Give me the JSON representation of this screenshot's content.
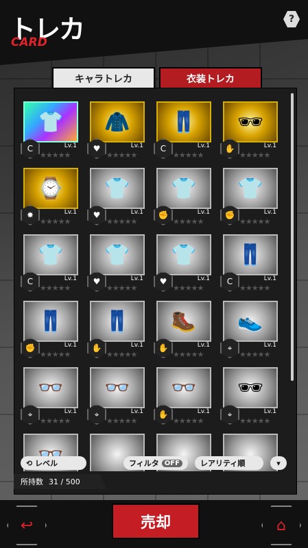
{
  "header": {
    "title": "トレカ",
    "subtitle": "CARD",
    "help": "?"
  },
  "tabs": [
    {
      "label": "キャラトレカ",
      "active": false
    },
    {
      "label": "衣装トレカ",
      "active": true
    }
  ],
  "cards": [
    {
      "icon": "👕",
      "frame": "rainbow",
      "level": "Lv.1",
      "badge": "c"
    },
    {
      "icon": "🧥",
      "frame": "gold",
      "level": "Lv.1",
      "badge": "heart"
    },
    {
      "icon": "👖",
      "frame": "gold",
      "level": "Lv.1",
      "badge": "c"
    },
    {
      "icon": "🕶",
      "frame": "gold",
      "level": "Lv.1",
      "badge": "hand"
    },
    {
      "icon": "⌚",
      "frame": "gold",
      "level": "Lv.1",
      "badge": "burst"
    },
    {
      "icon": "👕",
      "frame": "silver",
      "level": "Lv.1",
      "badge": "heart"
    },
    {
      "icon": "👕",
      "frame": "silver",
      "level": "Lv.1",
      "badge": "fist"
    },
    {
      "icon": "👕",
      "frame": "silver",
      "level": "Lv.1",
      "badge": "fist"
    },
    {
      "icon": "👕",
      "frame": "silver",
      "level": "Lv.1",
      "badge": "c"
    },
    {
      "icon": "👕",
      "frame": "silver",
      "level": "Lv.1",
      "badge": "heart"
    },
    {
      "icon": "👕",
      "frame": "silver",
      "level": "Lv.1",
      "badge": "heart"
    },
    {
      "icon": "👖",
      "frame": "silver",
      "level": "Lv.1",
      "badge": "c"
    },
    {
      "icon": "👖",
      "frame": "silver",
      "level": "Lv.1",
      "badge": "fist"
    },
    {
      "icon": "👖",
      "frame": "silver",
      "level": "Lv.1",
      "badge": "hand"
    },
    {
      "icon": "🥾",
      "frame": "silver",
      "level": "Lv.1",
      "badge": "hand"
    },
    {
      "icon": "👟",
      "frame": "silver",
      "level": "Lv.1",
      "badge": "target"
    },
    {
      "icon": "👓",
      "frame": "silver",
      "level": "Lv.1",
      "badge": "target"
    },
    {
      "icon": "👓",
      "frame": "silver",
      "level": "Lv.1",
      "badge": "target"
    },
    {
      "icon": "👓",
      "frame": "silver",
      "level": "Lv.1",
      "badge": "hand"
    },
    {
      "icon": "🕶",
      "frame": "silver",
      "level": "Lv.1",
      "badge": "target"
    },
    {
      "icon": "👓",
      "frame": "silver",
      "level": "",
      "badge": ""
    },
    {
      "icon": "",
      "frame": "silver",
      "level": "",
      "badge": ""
    },
    {
      "icon": "",
      "frame": "silver",
      "level": "",
      "badge": ""
    },
    {
      "icon": "",
      "frame": "silver",
      "level": "",
      "badge": ""
    }
  ],
  "stars": "★★★★★",
  "sort": {
    "level": "レベル",
    "filter": "フィルタ",
    "filter_state": "OFF",
    "rarity": "レアリティ順"
  },
  "inventory": {
    "label": "所持数",
    "value": "31 / 500"
  },
  "footer": {
    "sell": "売却"
  }
}
